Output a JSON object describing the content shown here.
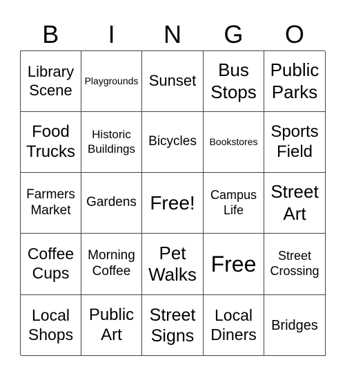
{
  "card": {
    "header": [
      "B",
      "I",
      "N",
      "G",
      "O"
    ],
    "rows": [
      [
        "Library Scene",
        "Playgrounds",
        "Sunset",
        "Bus Stops",
        "Public Parks"
      ],
      [
        "Food Trucks",
        "Historic Buildings",
        "Bicycles",
        "Bookstores",
        "Sports Field"
      ],
      [
        "Farmers Market",
        "Gardens",
        "Free!",
        "Campus Life",
        "Street Art"
      ],
      [
        "Coffee Cups",
        "Morning Coffee",
        "Pet Walks",
        "Free",
        "Street Crossing"
      ],
      [
        "Local Shops",
        "Public Art",
        "Street Signs",
        "Local Diners",
        "Bridges"
      ]
    ]
  },
  "colors": {
    "grid_line": "#444444",
    "text": "#000000",
    "background": "#ffffff"
  }
}
